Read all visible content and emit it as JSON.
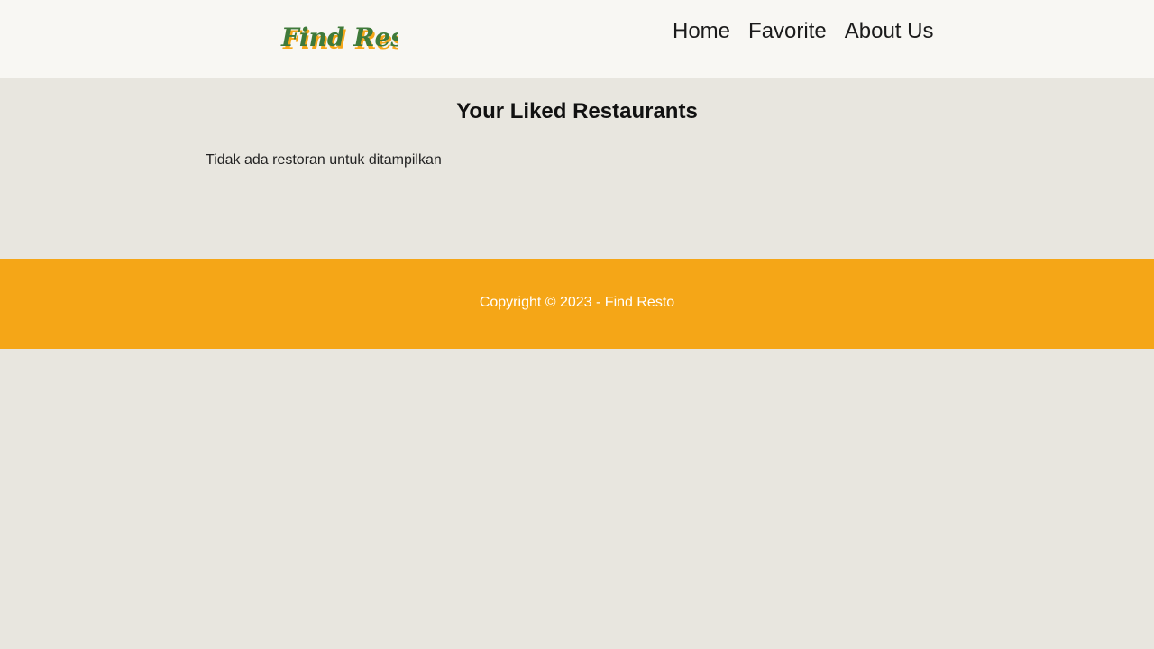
{
  "brand": {
    "logo_text": "Find Resto",
    "logo_colors": {
      "primary": "#3f7a3a",
      "shadow": "#f5a617"
    }
  },
  "nav": {
    "items": [
      {
        "label": "Home"
      },
      {
        "label": "Favorite"
      },
      {
        "label": "About Us"
      }
    ]
  },
  "main": {
    "title": "Your Liked Restaurants",
    "empty_message": "Tidak ada restoran untuk ditampilkan"
  },
  "footer": {
    "copyright": "Copyright © 2023 - Find Resto"
  },
  "colors": {
    "navbar_bg": "#f8f7f3",
    "page_bg": "#e8e6df",
    "footer_bg": "#f5a617",
    "footer_text": "#ffffff"
  }
}
